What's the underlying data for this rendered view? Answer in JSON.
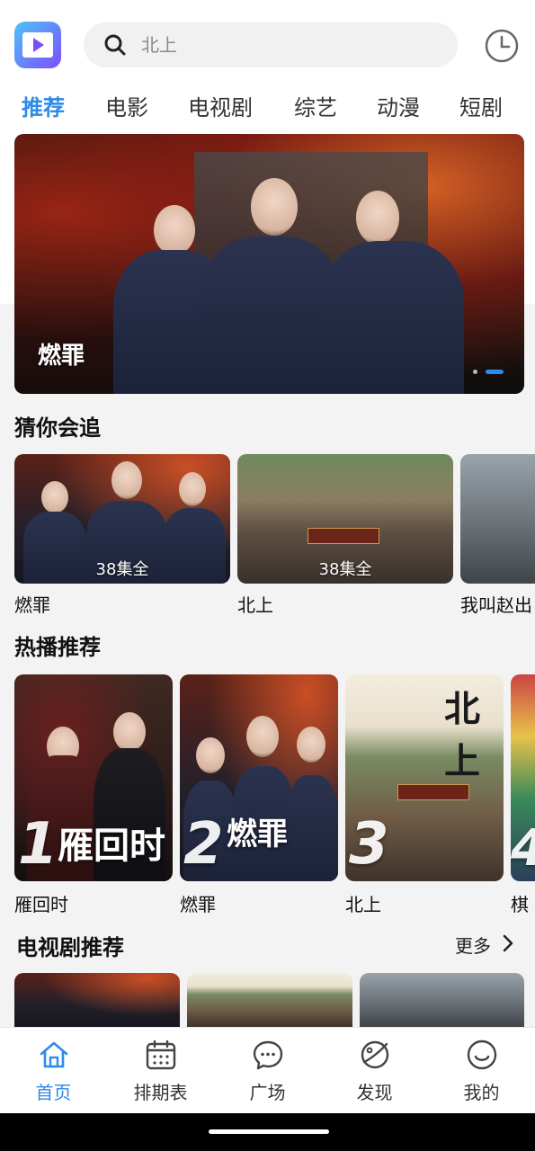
{
  "header": {
    "search_placeholder": "北上"
  },
  "tabs": [
    {
      "label": "推荐",
      "active": true
    },
    {
      "label": "电影",
      "active": false
    },
    {
      "label": "电视剧",
      "active": false
    },
    {
      "label": "综艺",
      "active": false
    },
    {
      "label": "动漫",
      "active": false
    },
    {
      "label": "短剧",
      "active": false
    }
  ],
  "banner": {
    "title": "燃罪",
    "slide_count": 2,
    "current_slide": 2
  },
  "guess": {
    "title": "猜你会追",
    "items": [
      {
        "title": "燃罪",
        "episodes": "38集全"
      },
      {
        "title": "北上",
        "episodes": "38集全"
      },
      {
        "title": "我叫赵出"
      }
    ]
  },
  "hot": {
    "title": "热播推荐",
    "items": [
      {
        "rank": "1",
        "title": "雁回时"
      },
      {
        "rank": "2",
        "title": "燃罪"
      },
      {
        "rank": "3",
        "title": "北上"
      },
      {
        "rank": "4",
        "title": "棋"
      }
    ]
  },
  "tv": {
    "title": "电视剧推荐",
    "more": "更多"
  },
  "nav": [
    {
      "label": "首页",
      "icon": "home-icon",
      "active": true
    },
    {
      "label": "排期表",
      "icon": "calendar-icon",
      "active": false
    },
    {
      "label": "广场",
      "icon": "chat-icon",
      "active": false
    },
    {
      "label": "发现",
      "icon": "planet-icon",
      "active": false
    },
    {
      "label": "我的",
      "icon": "smile-icon",
      "active": false
    }
  ],
  "colors": {
    "accent": "#2f8ae8",
    "background": "#f3f3f3"
  }
}
